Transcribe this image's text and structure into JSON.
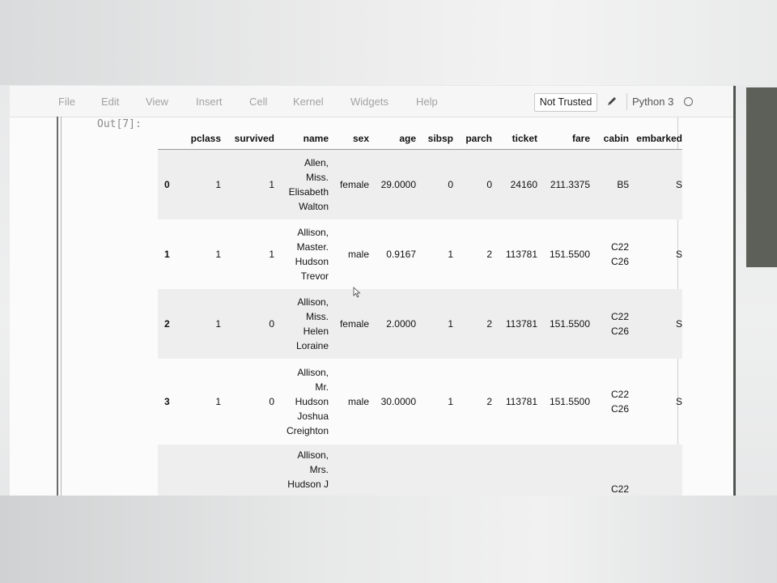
{
  "menu": {
    "items": [
      "File",
      "Edit",
      "View",
      "Insert",
      "Cell",
      "Kernel",
      "Widgets",
      "Help"
    ],
    "trust_label": "Not Trusted",
    "kernel_label": "Python 3"
  },
  "output": {
    "prompt": "Out[7]:",
    "columns": [
      "",
      "pclass",
      "survived",
      "name",
      "sex",
      "age",
      "sibsp",
      "parch",
      "ticket",
      "fare",
      "cabin",
      "embarked"
    ],
    "rows": [
      {
        "index": "0",
        "pclass": "1",
        "survived": "1",
        "name": [
          "Allen,",
          "Miss.",
          "Elisabeth",
          "Walton"
        ],
        "sex": "female",
        "age": "29.0000",
        "sibsp": "0",
        "parch": "0",
        "ticket": "24160",
        "fare": "211.3375",
        "cabin": [
          "B5"
        ],
        "embarked": "S"
      },
      {
        "index": "1",
        "pclass": "1",
        "survived": "1",
        "name": [
          "Allison,",
          "Master.",
          "Hudson",
          "Trevor"
        ],
        "sex": "male",
        "age": "0.9167",
        "sibsp": "1",
        "parch": "2",
        "ticket": "113781",
        "fare": "151.5500",
        "cabin": [
          "C22",
          "C26"
        ],
        "embarked": "S"
      },
      {
        "index": "2",
        "pclass": "1",
        "survived": "0",
        "name": [
          "Allison,",
          "Miss.",
          "Helen",
          "Loraine"
        ],
        "sex": "female",
        "age": "2.0000",
        "sibsp": "1",
        "parch": "2",
        "ticket": "113781",
        "fare": "151.5500",
        "cabin": [
          "C22",
          "C26"
        ],
        "embarked": "S"
      },
      {
        "index": "3",
        "pclass": "1",
        "survived": "0",
        "name": [
          "Allison,",
          "Mr.",
          "Hudson",
          "Joshua",
          "Creighton"
        ],
        "sex": "male",
        "age": "30.0000",
        "sibsp": "1",
        "parch": "2",
        "ticket": "113781",
        "fare": "151.5500",
        "cabin": [
          "C22",
          "C26"
        ],
        "embarked": "S"
      },
      {
        "index": "",
        "pclass": "",
        "survived": "",
        "name": [
          "Allison,",
          "Mrs.",
          "Hudson J"
        ],
        "sex": "",
        "age": "",
        "sibsp": "",
        "parch": "",
        "ticket": "",
        "fare": "",
        "cabin": [
          "C22"
        ],
        "embarked": ""
      }
    ]
  },
  "colors": {
    "menu_text": "#a2a2a2",
    "row_alt": "#eeeeee",
    "side_panel": "#5c6058"
  },
  "icons": [
    "pencil-icon",
    "kernel-idle-icon",
    "mouse-cursor-icon"
  ]
}
